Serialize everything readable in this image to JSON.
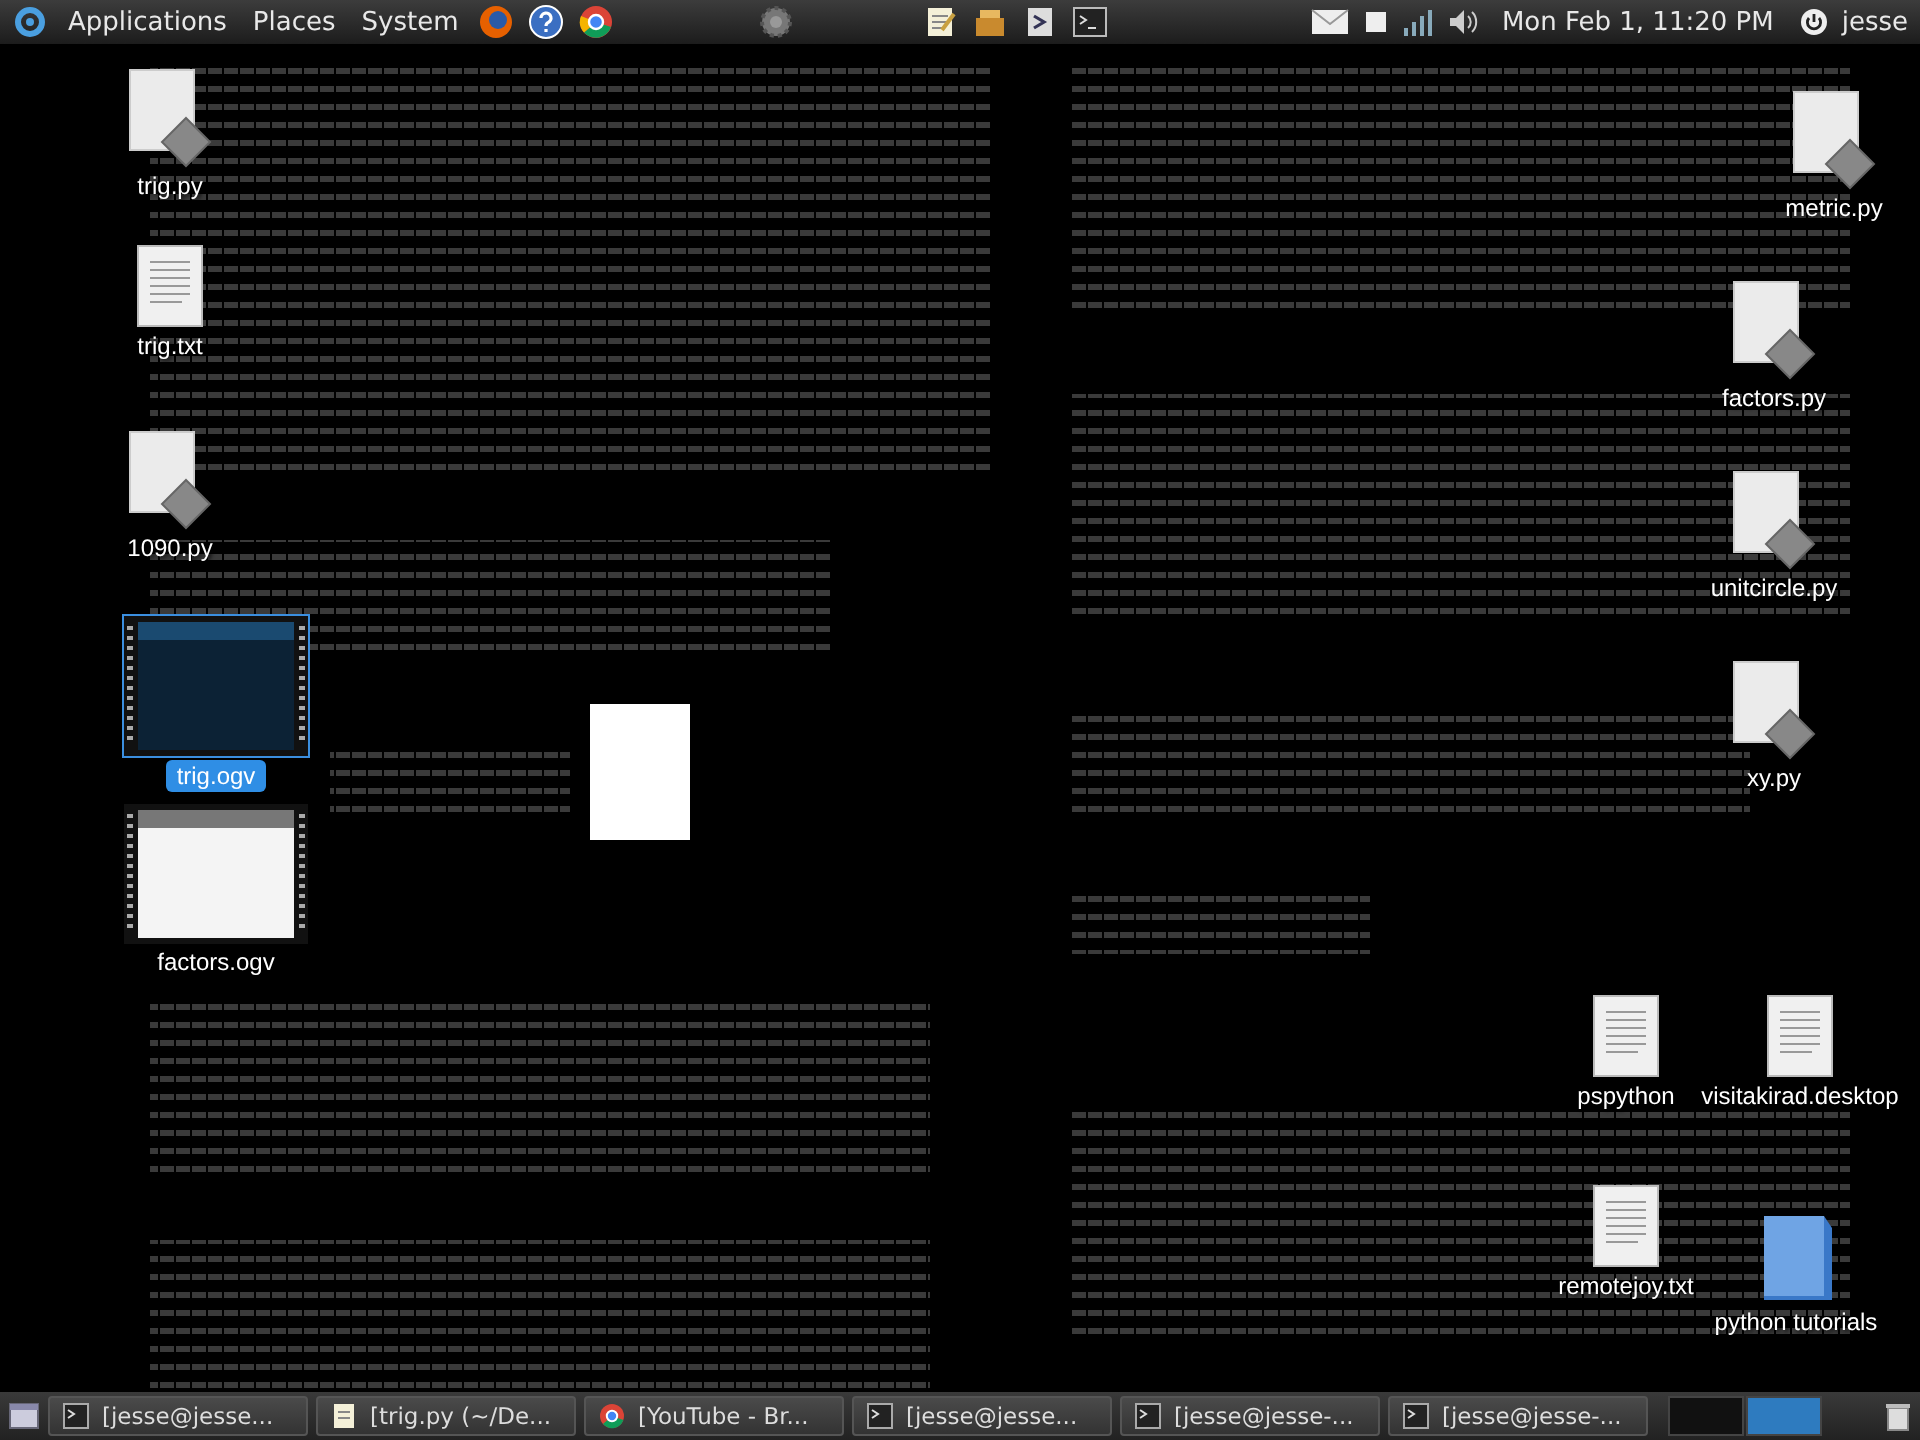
{
  "top_panel": {
    "menus": [
      "Applications",
      "Places",
      "System"
    ],
    "clock": "Mon Feb  1, 11:20 PM",
    "user": "jesse"
  },
  "desktop": {
    "icons": [
      {
        "label": "trig.py",
        "kind": "python",
        "selected": false
      },
      {
        "label": "trig.txt",
        "kind": "text",
        "selected": false
      },
      {
        "label": "1090.py",
        "kind": "python",
        "selected": false
      },
      {
        "label": "trig.ogv",
        "kind": "video",
        "selected": true
      },
      {
        "label": "factors.ogv",
        "kind": "video",
        "selected": false
      },
      {
        "label": "metric.py",
        "kind": "python",
        "selected": false
      },
      {
        "label": "factors.py",
        "kind": "python",
        "selected": false
      },
      {
        "label": "unitcircle.py",
        "kind": "python",
        "selected": false
      },
      {
        "label": "xy.py",
        "kind": "python",
        "selected": false
      },
      {
        "label": "pspython",
        "kind": "text",
        "selected": false
      },
      {
        "label": "visitakirad.desktop",
        "kind": "text",
        "selected": false
      },
      {
        "label": "remotejoy.txt",
        "kind": "text",
        "selected": false
      },
      {
        "label": "python tutorials",
        "kind": "folder",
        "selected": false
      }
    ]
  },
  "taskbar": {
    "tasks": [
      {
        "label": "[jesse@jesse...",
        "kind": "terminal"
      },
      {
        "label": "[trig.py (~/De...",
        "kind": "editor"
      },
      {
        "label": "[YouTube - Br...",
        "kind": "browser"
      },
      {
        "label": "[jesse@jesse...",
        "kind": "terminal"
      },
      {
        "label": "[jesse@jesse-...",
        "kind": "terminal"
      },
      {
        "label": "[jesse@jesse-...",
        "kind": "terminal"
      }
    ],
    "workspaces": [
      {
        "selected": false
      },
      {
        "selected": true
      }
    ]
  }
}
